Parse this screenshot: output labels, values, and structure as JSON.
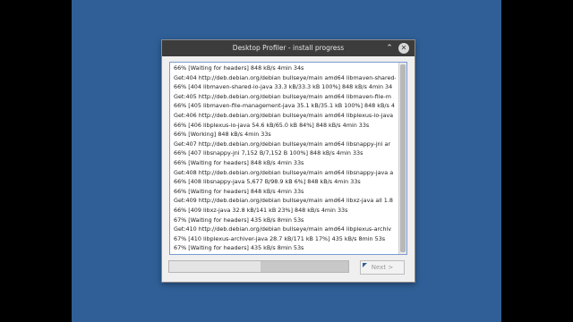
{
  "window": {
    "title": "Desktop Profiler - install progress",
    "collapse_icon": "chevron-up-icon",
    "close_icon": "close-icon"
  },
  "log": {
    "lines": [
      "66% [Waiting for headers] 848 kB/s 4min 34s",
      "Get:404 http://deb.debian.org/debian bullseye/main amd64 libmaven-shared-",
      "66% [404 libmaven-shared-io-java 33.3 kB/33.3 kB 100%] 848 kB/s 4min 34",
      "Get:405 http://deb.debian.org/debian bullseye/main amd64 libmaven-file-m",
      "66% [405 libmaven-file-management-java 35.1 kB/35.1 kB 100%] 848 kB/s 4",
      "Get:406 http://deb.debian.org/debian bullseye/main amd64 libplexus-io-java",
      "66% [406 libplexus-io-java 54.6 kB/65.0 kB 84%] 848 kB/s 4min 33s",
      "66% [Working] 848 kB/s 4min 33s",
      "Get:407 http://deb.debian.org/debian bullseye/main amd64 libsnappy-jni ar",
      "66% [407 libsnappy-jni 7,152 B/7,152 B 100%] 848 kB/s 4min 33s",
      "66% [Waiting for headers] 848 kB/s 4min 33s",
      "Get:408 http://deb.debian.org/debian bullseye/main amd64 libsnappy-java a",
      "66% [408 libsnappy-java 5,677 B/98.9 kB 6%] 848 kB/s 4min 33s",
      "66% [Waiting for headers] 848 kB/s 4min 33s",
      "Get:409 http://deb.debian.org/debian bullseye/main amd64 libxz-java all 1.8",
      "66% [409 libxz-java 32.8 kB/141 kB 23%] 848 kB/s 4min 33s",
      "67% [Waiting for headers] 435 kB/s 8min 53s",
      "Get:410 http://deb.debian.org/debian bullseye/main amd64 libplexus-archiv",
      "67% [410 libplexus-archiver-java 28.7 kB/171 kB 17%] 435 kB/s 8min 53s",
      "67% [Waiting for headers] 435 kB/s 8min 53s"
    ]
  },
  "progress": {
    "fraction": 0.51
  },
  "next_button": {
    "label": "Next >"
  },
  "colors": {
    "desktop": "#2f5f96",
    "titlebar": "#3c3c3c",
    "log_border": "#7a9bd1"
  }
}
